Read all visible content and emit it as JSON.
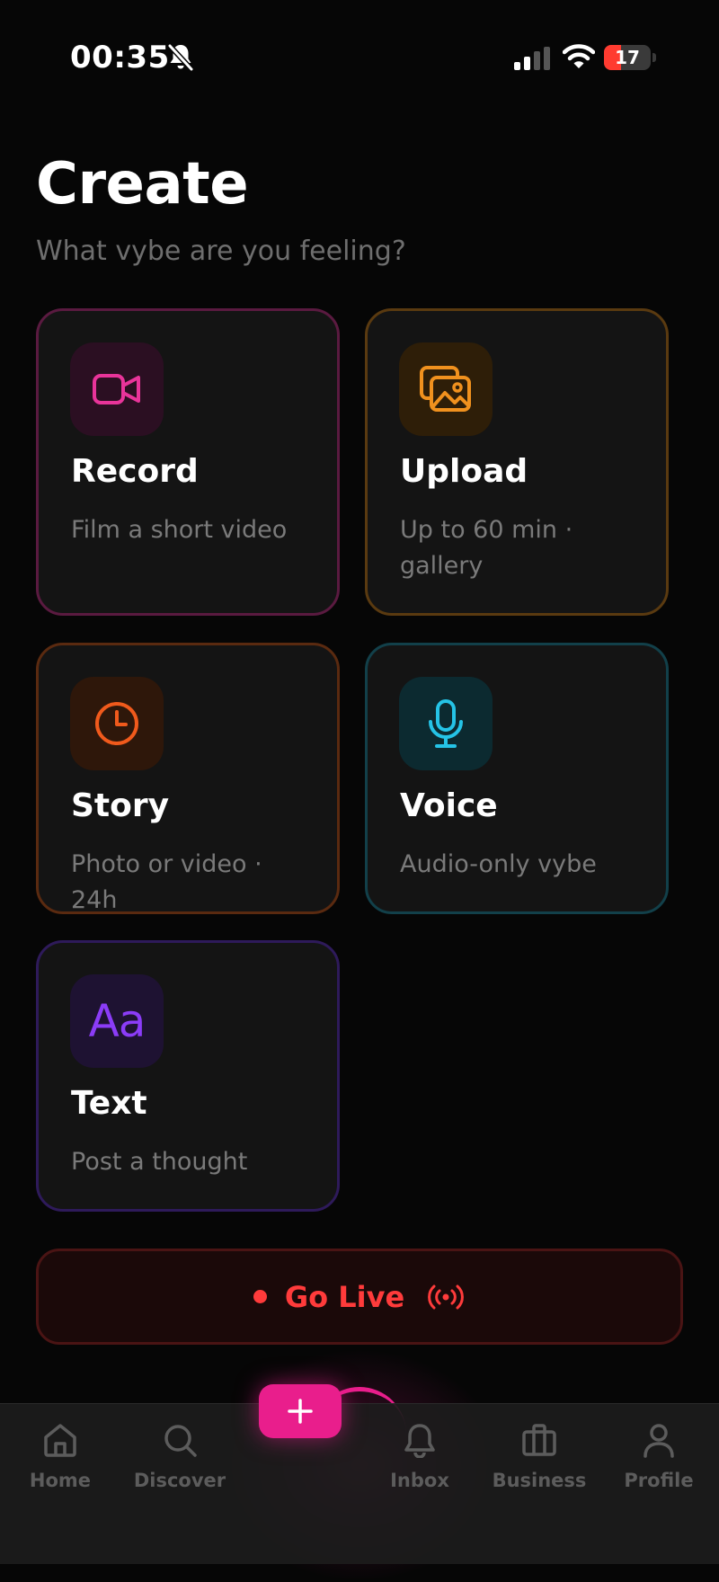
{
  "status_bar": {
    "time": "00:35",
    "battery_level": "17",
    "battery_fraction": 0.17,
    "icons": [
      "bell-slash-icon",
      "cellular-signal-icon",
      "wifi-icon",
      "battery-icon"
    ]
  },
  "header": {
    "title": "Create",
    "subtitle": "What vybe are you feeling?"
  },
  "options": {
    "record": {
      "title": "Record",
      "description": "Film a short video",
      "icon": "video-camera-icon",
      "accent": "#e8349a"
    },
    "upload": {
      "title": "Upload",
      "description": "Up to 60 min · gallery",
      "icon": "gallery-images-icon",
      "accent": "#f0911e"
    },
    "story": {
      "title": "Story",
      "description": "Photo or video · 24h",
      "icon": "clock-icon",
      "accent": "#f05a1c"
    },
    "voice": {
      "title": "Voice",
      "description": "Audio-only vybe",
      "icon": "microphone-icon",
      "accent": "#25c3e6"
    },
    "text": {
      "title": "Text",
      "description": "Post a thought",
      "icon": "text-aa-icon",
      "icon_glyph": "Aa",
      "accent": "#8b3cf7"
    }
  },
  "go_live": {
    "label": "Go Live",
    "accent": "#ff3b3b"
  },
  "bottom_nav": {
    "items": [
      {
        "label": "Home",
        "icon": "home-icon"
      },
      {
        "label": "Discover",
        "icon": "search-icon"
      },
      {
        "label": "",
        "icon": "plus-icon"
      },
      {
        "label": "Inbox",
        "icon": "bell-icon"
      },
      {
        "label": "Business",
        "icon": "briefcase-icon"
      },
      {
        "label": "Profile",
        "icon": "person-icon"
      }
    ],
    "active_accent": "#e91e8c"
  }
}
